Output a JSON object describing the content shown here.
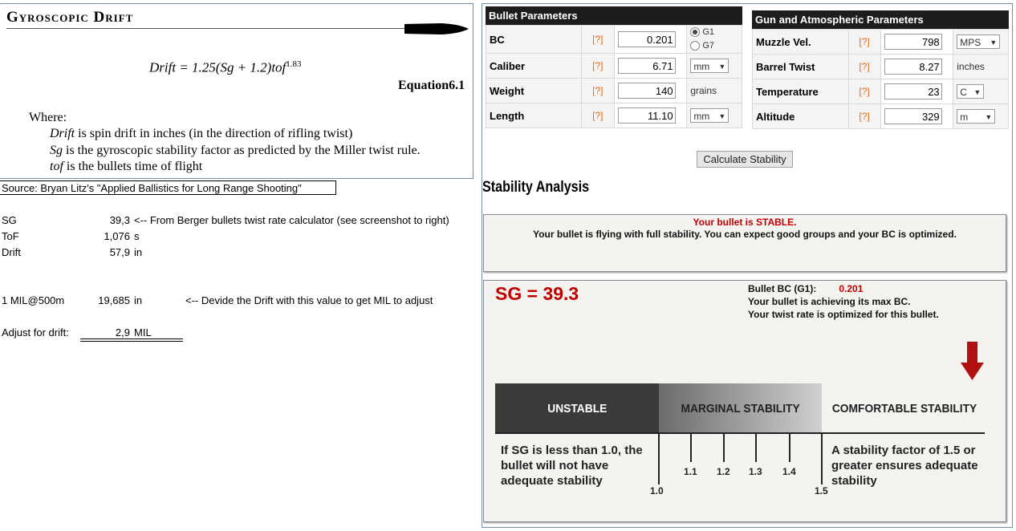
{
  "gyro": {
    "title": "Gyroscopic Drift",
    "equation_lhs": "Drift = 1.25(Sg + 1.2)tof",
    "equation_exp": "1.83",
    "equation_number": "Equation6.1",
    "where_label": "Where:",
    "defs": [
      {
        "term": "Drift",
        "desc": " is spin drift in inches (in the direction of rifling twist)"
      },
      {
        "term": "Sg",
        "desc": " is the gyroscopic stability factor as predicted by the Miller twist rule."
      },
      {
        "term": "tof",
        "desc": " is the bullets time of flight"
      }
    ]
  },
  "sheet": {
    "source": "Source: Bryan Litz's \"Applied Ballistics for Long Range Shooting\"",
    "rows": [
      {
        "label": "SG",
        "value": "39,3",
        "unit": "<-- From Berger bullets twist rate calculator (see screenshot to right)"
      },
      {
        "label": "ToF",
        "value": "1,076",
        "unit": "s"
      },
      {
        "label": "Drift",
        "value": "57,9",
        "unit": "in"
      }
    ],
    "mil_label": "1 MIL@500m",
    "mil_value": "19,685",
    "mil_unit": "in",
    "mil_note": "<-- Devide the Drift with this value to get MIL to adjust",
    "adjust_label": "Adjust for drift:",
    "adjust_value": "2,9",
    "adjust_unit": "MIL"
  },
  "bullet": {
    "header": "Bullet Parameters",
    "help": "[?]",
    "bc_label": "BC",
    "bc_value": "0.201",
    "g1": "G1",
    "g7": "G7",
    "caliber_label": "Caliber",
    "caliber_value": "6.71",
    "caliber_unit": "mm",
    "weight_label": "Weight",
    "weight_value": "140",
    "weight_unit": "grains",
    "length_label": "Length",
    "length_value": "11.10",
    "length_unit": "mm"
  },
  "gun": {
    "header": "Gun and Atmospheric Parameters",
    "help": "[?]",
    "mv_label": "Muzzle Vel.",
    "mv_value": "798",
    "mv_unit": "MPS",
    "twist_label": "Barrel Twist",
    "twist_value": "8.27",
    "twist_unit": "inches",
    "temp_label": "Temperature",
    "temp_value": "23",
    "temp_unit": "C",
    "alt_label": "Altitude",
    "alt_value": "329",
    "alt_unit": "m"
  },
  "calculate_label": "Calculate Stability",
  "analysis": {
    "heading": "Stability Analysis",
    "status": "Your bullet is STABLE.",
    "message": "Your bullet is flying with full stability. You can expect good groups and your BC is optimized.",
    "sg": "SG = 39.3",
    "bc_line_label": "Bullet BC (G1):",
    "bc_line_value": "0.201",
    "line2": "Your bullet is achieving its max BC.",
    "line3": "Your twist rate is optimized for this bullet."
  },
  "scale": {
    "unstable": "UNSTABLE",
    "marginal": "MARGINAL STABILITY",
    "comfortable": "COMFORTABLE STABILITY",
    "unstable_desc": "If SG is less than 1.0, the bullet will not have adequate stability",
    "comfortable_desc": "A stability factor of 1.5 or greater ensures adequate stability",
    "ticks": [
      "1.0",
      "1.1",
      "1.2",
      "1.3",
      "1.4",
      "1.5"
    ]
  },
  "colors": {
    "help": "#e46a16",
    "stable": "#c00000",
    "arrow": "#b01010",
    "header": "#1d1d1d"
  }
}
